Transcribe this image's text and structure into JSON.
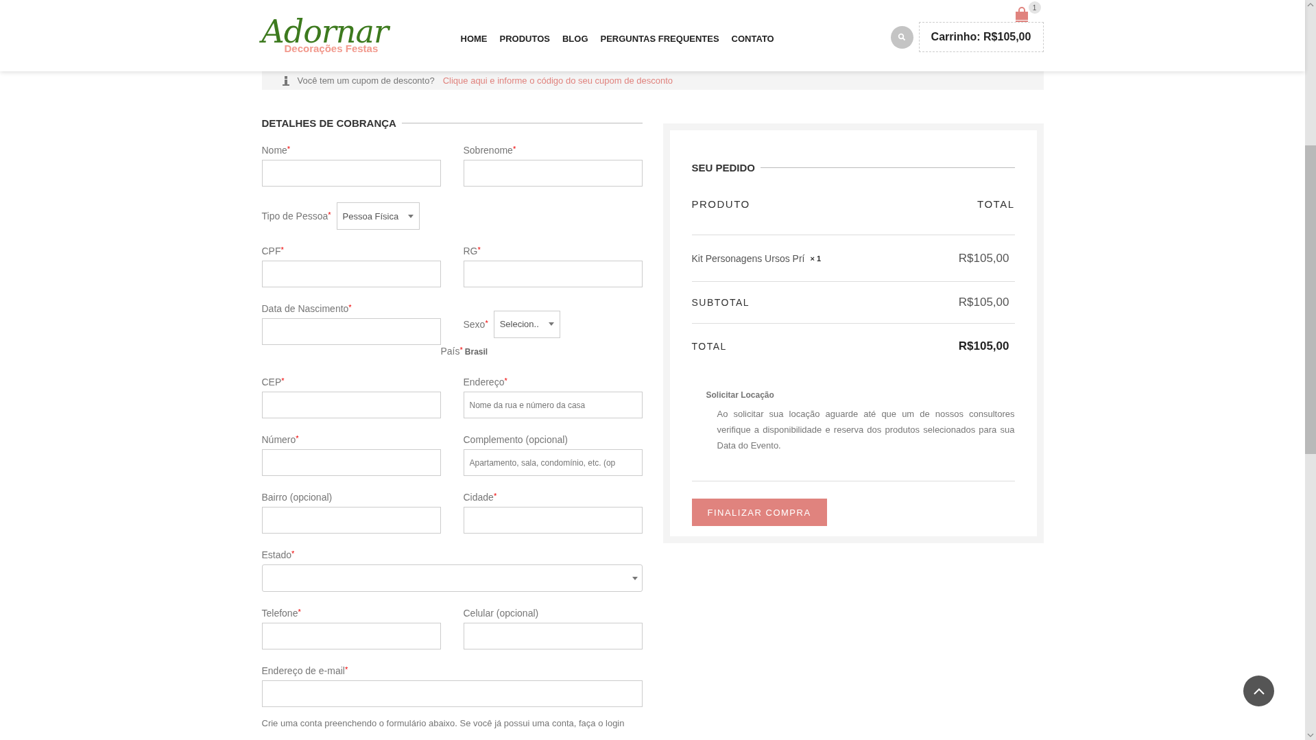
{
  "header": {
    "logo": {
      "script": "Adornar",
      "tagline": "Decorações Festas"
    },
    "nav": [
      "HOME",
      "PRODUTOS",
      "BLOG",
      "PERGUNTAS FREQUENTES",
      "CONTATO"
    ],
    "cart": {
      "label": "Carrinho: R$105,00",
      "count": "1"
    }
  },
  "coupon": {
    "text": "Você tem um cupom de desconto?",
    "link": "Clique aqui e informe o código do seu cupom de desconto"
  },
  "billing": {
    "title": "DETALHES DE COBRANÇA",
    "required_mark": "*",
    "rows": [
      {
        "fields": [
          {
            "kind": "text",
            "label": "Nome",
            "required": true
          },
          {
            "kind": "text",
            "label": "Sobrenome",
            "required": true
          }
        ]
      },
      {
        "fields": [
          {
            "kind": "inline-select",
            "label": "Tipo de Pessoa",
            "required": true,
            "value": "Pessoa Física"
          }
        ]
      },
      {
        "fields": [
          {
            "kind": "text",
            "label": "CPF",
            "required": true
          },
          {
            "kind": "text",
            "label": "RG",
            "required": true
          }
        ]
      },
      {
        "fields": [
          {
            "kind": "text",
            "label": "Data de Nascimento",
            "required": true
          },
          {
            "kind": "inline-select",
            "label": "Sexo",
            "required": true,
            "value": "Selecion.."
          }
        ]
      },
      {
        "fields": [
          {
            "kind": "static",
            "label": "País",
            "required": true,
            "value": "Brasil"
          }
        ]
      },
      {
        "fields": [
          {
            "kind": "text",
            "label": "CEP",
            "required": true
          },
          {
            "kind": "text",
            "label": "Endereço",
            "required": true,
            "placeholder": "Nome da rua e número da casa"
          }
        ]
      },
      {
        "fields": [
          {
            "kind": "text",
            "label": "Número",
            "required": true
          },
          {
            "kind": "text",
            "label": "Complemento (opcional)",
            "required": false,
            "placeholder": "Apartamento, sala, condomínio, etc. (op"
          }
        ]
      },
      {
        "fields": [
          {
            "kind": "text",
            "label": "Bairro (opcional)",
            "required": false
          },
          {
            "kind": "text",
            "label": "Cidade",
            "required": true
          }
        ]
      },
      {
        "fields": [
          {
            "kind": "select",
            "label": "Estado",
            "required": true,
            "full": true
          }
        ]
      },
      {
        "fields": [
          {
            "kind": "text",
            "label": "Telefone",
            "required": true
          },
          {
            "kind": "text",
            "label": "Celular (opcional)",
            "required": false
          }
        ]
      },
      {
        "fields": [
          {
            "kind": "text",
            "label": "Endereço de e-mail",
            "required": true,
            "full": true
          }
        ]
      }
    ],
    "note": "Crie uma conta preenchendo o formulário abaixo. Se você já possui uma conta, faça o login"
  },
  "order": {
    "title": "SEU PEDIDO",
    "columns": [
      "PRODUTO",
      "TOTAL"
    ],
    "items": [
      {
        "name": "Kit Personagens Ursos Prí",
        "quantity": "× 1",
        "total": "R$105,00"
      }
    ],
    "subtotal": {
      "label": "SUBTOTAL",
      "value": "R$105,00"
    },
    "total": {
      "label": "TOTAL",
      "value": "R$105,00"
    },
    "payment": {
      "title": "Solicitar Locação",
      "description": "Ao solicitar sua locação aguarde até que um de nossos consultores verifique a disponibilidade e reserva dos produtos selecionados para sua Data do Evento."
    },
    "button": "FINALIZAR COMPRA"
  }
}
